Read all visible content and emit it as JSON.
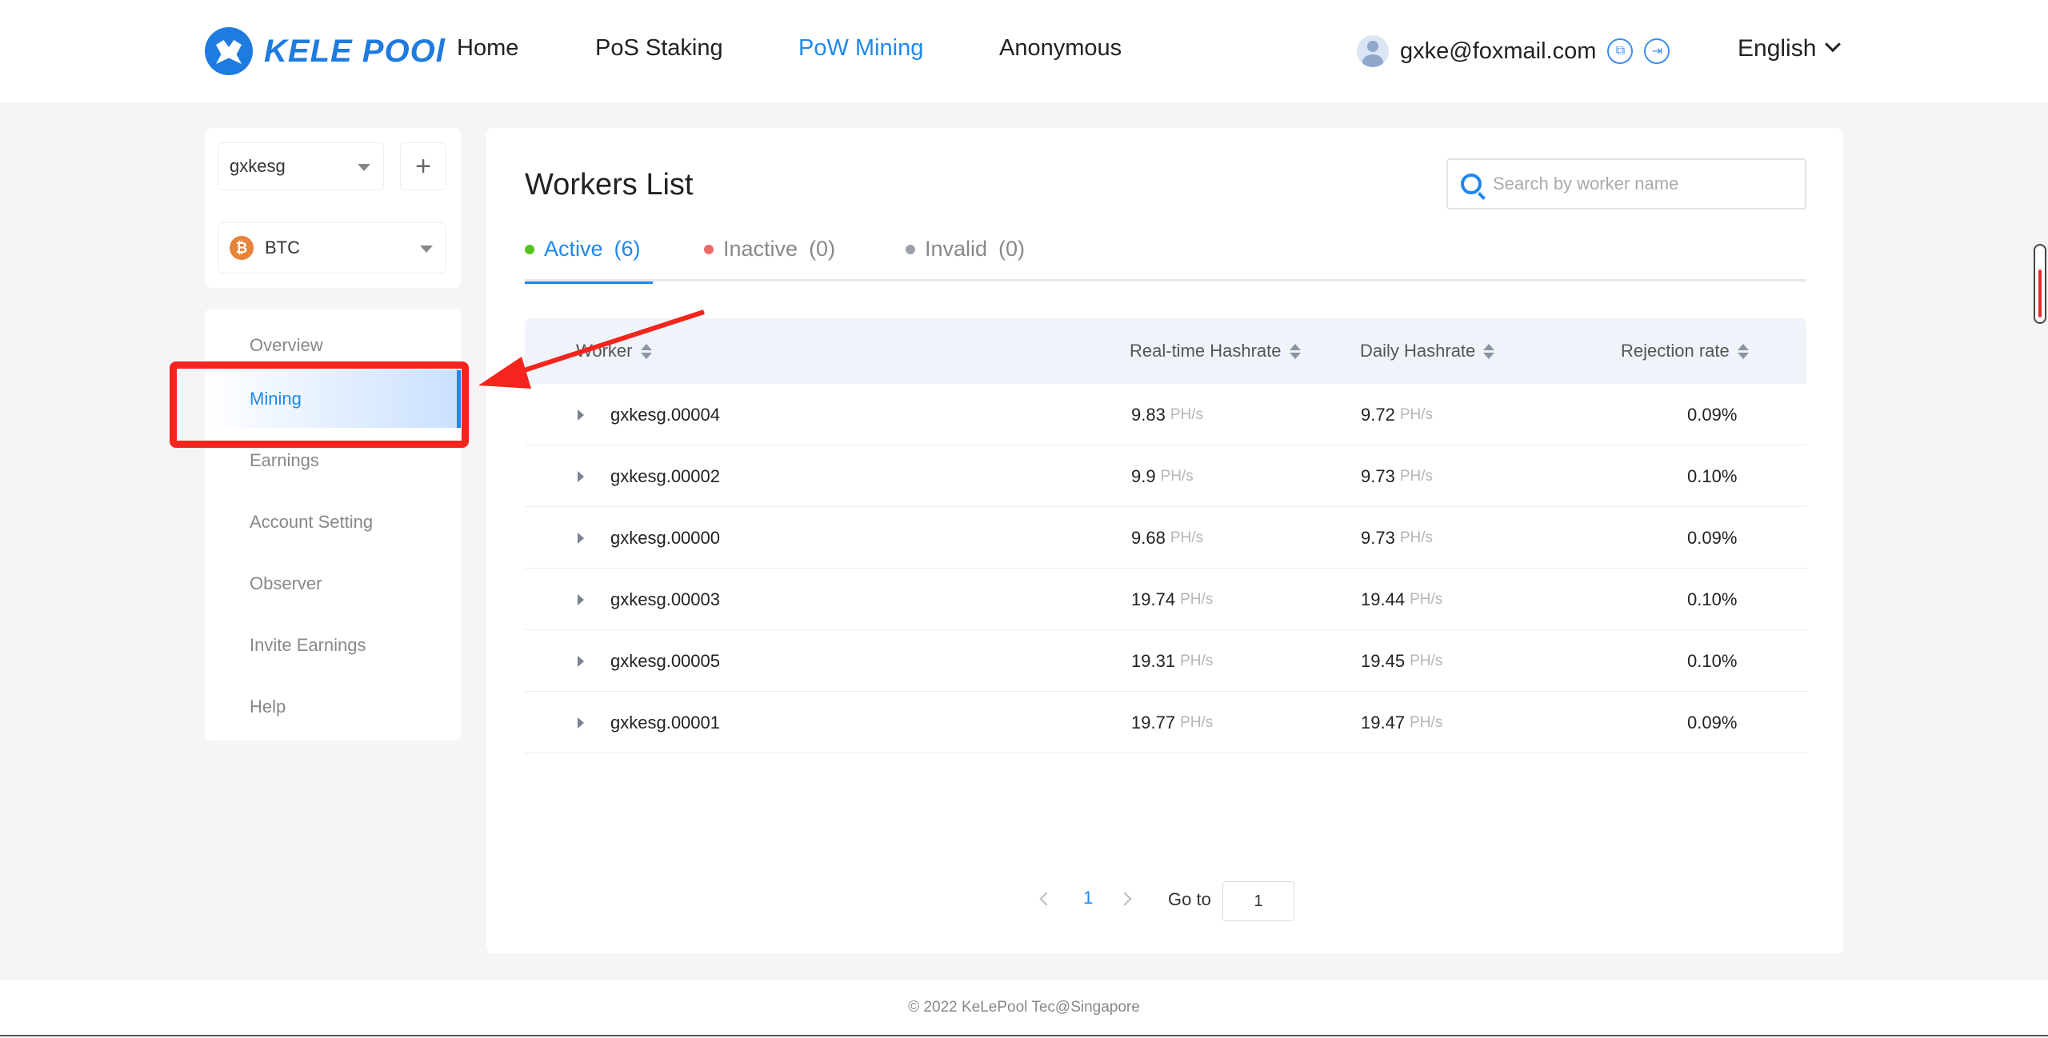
{
  "header": {
    "logo_text": "KELE POOl",
    "nav": [
      "Home",
      "PoS Staking",
      "PoW Mining",
      "Anonymous"
    ],
    "active_nav": "PoW Mining",
    "user_email": "gxke@foxmail.com",
    "language": "English"
  },
  "sidebar": {
    "account": "gxkesg",
    "add_symbol": "+",
    "coin": "BTC",
    "coin_symbol": "₿",
    "menu": [
      "Overview",
      "Mining",
      "Earnings",
      "Account Setting",
      "Observer",
      "Invite Earnings",
      "Help"
    ],
    "active_menu": "Mining"
  },
  "main": {
    "title": "Workers List",
    "search_placeholder": "Search by worker name",
    "tabs": [
      {
        "label": "Active",
        "count": "(6)",
        "color": "#52c41a"
      },
      {
        "label": "Inactive",
        "count": "(0)",
        "color": "#f06a6a"
      },
      {
        "label": "Invalid",
        "count": "(0)",
        "color": "#9aa1ab"
      }
    ],
    "columns": [
      "Worker",
      "Real-time Hashrate",
      "Daily Hashrate",
      "Rejection rate"
    ],
    "unit": "PH/s",
    "rows": [
      {
        "worker": "gxkesg.00004",
        "realtime": "9.83",
        "daily": "9.72",
        "rejection": "0.09%"
      },
      {
        "worker": "gxkesg.00002",
        "realtime": "9.9",
        "daily": "9.73",
        "rejection": "0.10%"
      },
      {
        "worker": "gxkesg.00000",
        "realtime": "9.68",
        "daily": "9.73",
        "rejection": "0.09%"
      },
      {
        "worker": "gxkesg.00003",
        "realtime": "19.74",
        "daily": "19.44",
        "rejection": "0.10%"
      },
      {
        "worker": "gxkesg.00005",
        "realtime": "19.31",
        "daily": "19.45",
        "rejection": "0.10%"
      },
      {
        "worker": "gxkesg.00001",
        "realtime": "19.77",
        "daily": "19.47",
        "rejection": "0.09%"
      }
    ],
    "pagination": {
      "current": "1",
      "goto_label": "Go to",
      "goto_value": "1"
    }
  },
  "footer": {
    "text": "© 2022 KeLePool Tec@Singapore"
  },
  "colors": {
    "accent": "#1e88f0",
    "annotation": "#f5241c"
  }
}
